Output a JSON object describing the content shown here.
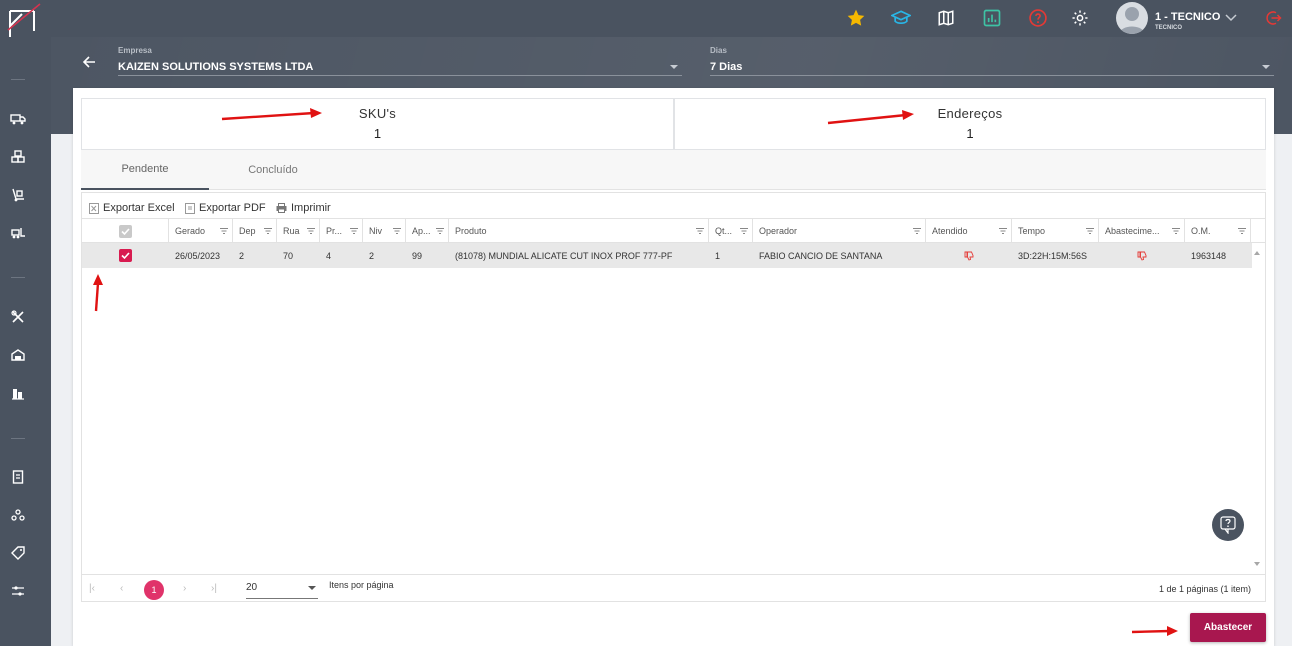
{
  "topbar": {
    "user_name": "1 - TECNICO",
    "user_role": "TECNICO",
    "icons": [
      "star-icon",
      "graduation-cap-icon",
      "map-icon",
      "chart-icon",
      "help-icon",
      "gear-icon",
      "chevron-down-icon",
      "logout-icon"
    ],
    "colors": {
      "bar": "#4a5360",
      "star": "#f5b800",
      "cap": "#29b6e6",
      "chart": "#3ec3a5",
      "help": "#e53935",
      "logout": "#e53935"
    }
  },
  "filters": {
    "empresa_label": "Empresa",
    "empresa_value": "KAIZEN SOLUTIONS SYSTEMS LTDA",
    "dias_label": "Dias",
    "dias_value": "7 Dias"
  },
  "stats": {
    "skus_label": "SKU's",
    "skus_value": "1",
    "enderecos_label": "Endereços",
    "enderecos_value": "1"
  },
  "tabs": [
    {
      "label": "Pendente",
      "active": true
    },
    {
      "label": "Concluído",
      "active": false
    }
  ],
  "toolbar": {
    "export_excel": "Exportar Excel",
    "export_pdf": "Exportar PDF",
    "print": "Imprimir"
  },
  "table": {
    "columns": [
      "Gerado",
      "Dep",
      "Rua",
      "Pr...",
      "Niv",
      "Ap...",
      "Produto",
      "Qt...",
      "Operador",
      "Atendido",
      "Tempo",
      "Abastecime...",
      "O.M."
    ],
    "rows": [
      {
        "checked": true,
        "gerado": "26/05/2023",
        "dep": "2",
        "rua": "70",
        "pr": "4",
        "niv": "2",
        "ap": "99",
        "produto": "(81078) MUNDIAL ALICATE CUT INOX PROF 777-PF",
        "qt": "1",
        "operador": "FABIO CANCIO DE SANTANA",
        "atendido": "thumbs-down-icon",
        "tempo": "3D:22H:15M:56S",
        "abastecimento": "thumbs-down-icon",
        "om": "1963148"
      }
    ]
  },
  "pager": {
    "current_page": "1",
    "page_size": "20",
    "per_page_label": "Itens por página",
    "info": "1 de 1 páginas (1 item)"
  },
  "actions": {
    "abastecer": "Abastecer",
    "accent": "#a8174f"
  }
}
